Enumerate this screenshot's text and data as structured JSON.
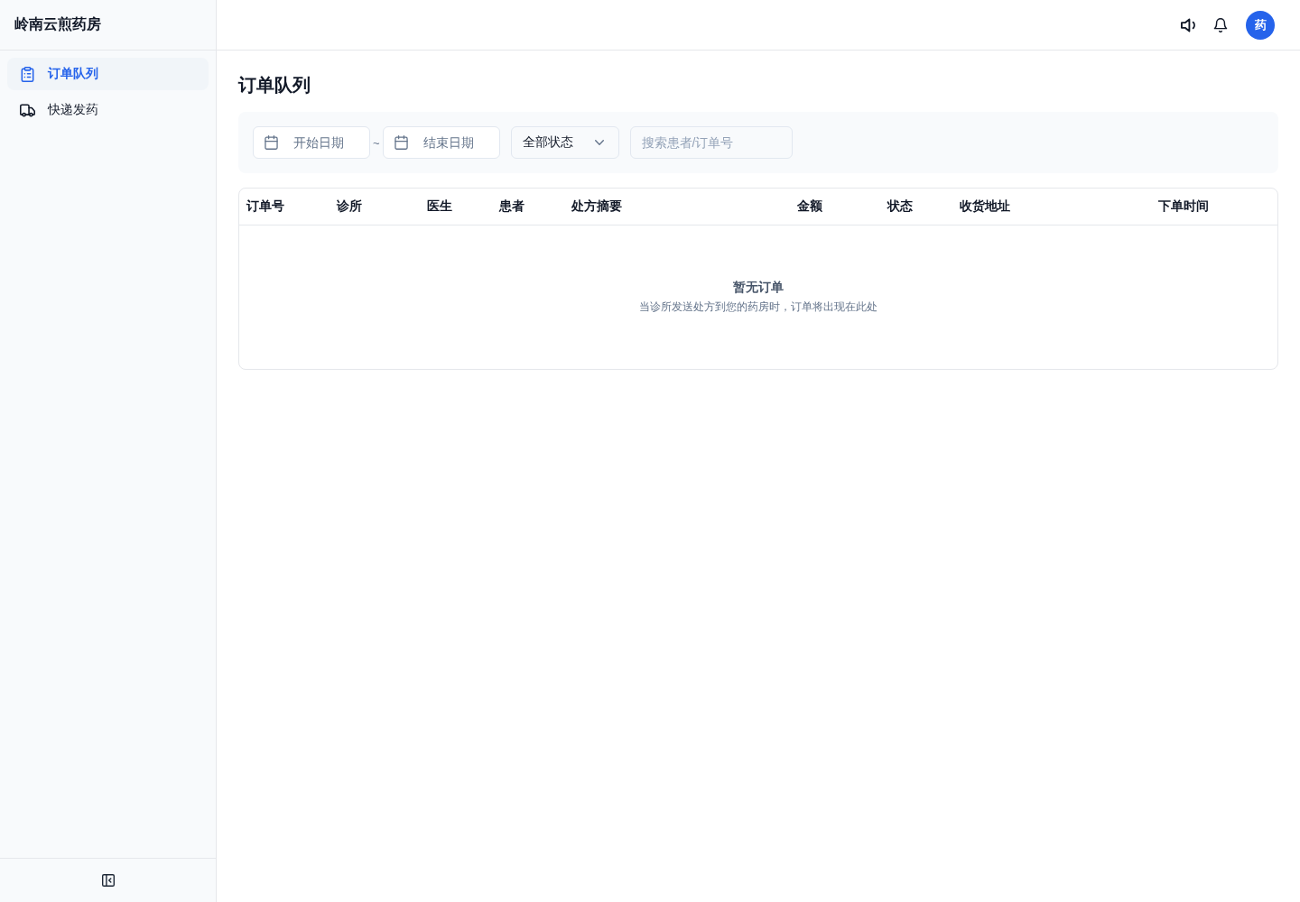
{
  "app": {
    "title": "岭南云煎药房"
  },
  "sidebar": {
    "items": [
      {
        "label": "订单队列",
        "selected": true
      },
      {
        "label": "快递发药",
        "selected": false
      }
    ]
  },
  "header": {
    "avatar": "药"
  },
  "page": {
    "title": "订单队列"
  },
  "filters": {
    "start_date": {
      "placeholder": "开始日期"
    },
    "separator": "~",
    "end_date": {
      "placeholder": "结束日期"
    },
    "status_select": {
      "value": "全部状态"
    },
    "search": {
      "placeholder": "搜索患者/订单号"
    }
  },
  "table": {
    "columns": [
      "订单号",
      "诊所",
      "医生",
      "患者",
      "处方摘要",
      "金额",
      "状态",
      "收货地址",
      "下单时间"
    ],
    "empty_state": {
      "title": "暂无订单",
      "message": "当诊所发送处方到您的药房时，订单将出现在此处"
    }
  }
}
